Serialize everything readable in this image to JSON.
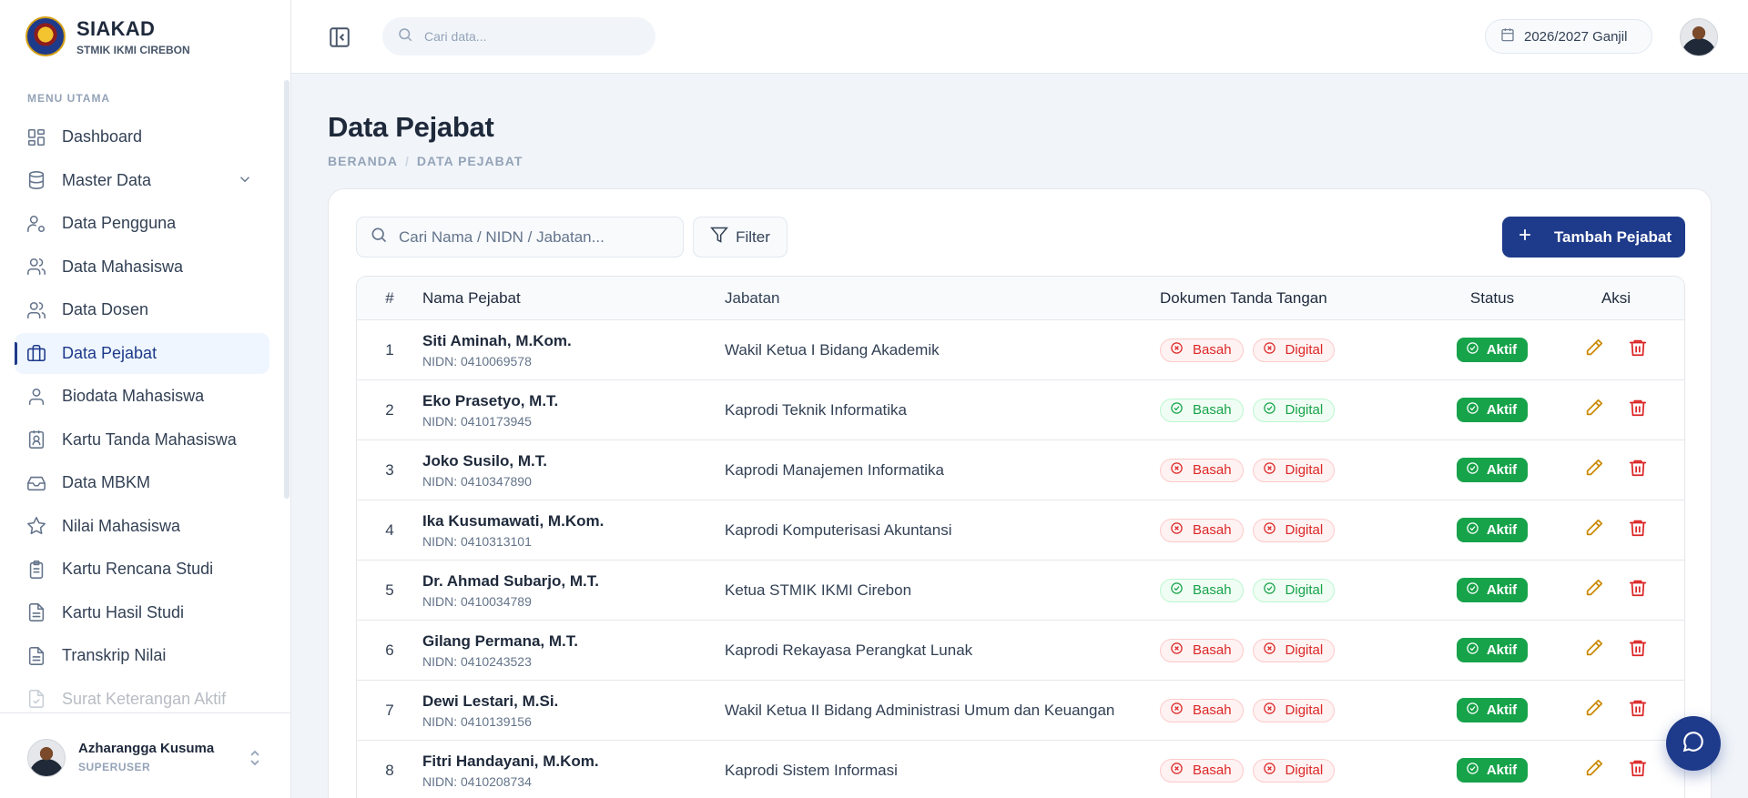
{
  "app": {
    "title": "SIAKAD",
    "subtitle": "STMIK IKMI CIREBON"
  },
  "sidebar": {
    "section_label": "MENU UTAMA",
    "items": [
      {
        "label": "Dashboard",
        "icon": "dashboard-icon"
      },
      {
        "label": "Master Data",
        "icon": "database-icon"
      },
      {
        "label": "Data Pengguna",
        "icon": "user-cog-icon"
      },
      {
        "label": "Data Mahasiswa",
        "icon": "users-icon"
      },
      {
        "label": "Data Dosen",
        "icon": "users-icon"
      },
      {
        "label": "Data Pejabat",
        "icon": "briefcase-icon"
      },
      {
        "label": "Biodata Mahasiswa",
        "icon": "user-icon"
      },
      {
        "label": "Kartu Tanda Mahasiswa",
        "icon": "id-card-icon"
      },
      {
        "label": "Data MBKM",
        "icon": "inbox-icon"
      },
      {
        "label": "Nilai Mahasiswa",
        "icon": "star-icon"
      },
      {
        "label": "Kartu Rencana Studi",
        "icon": "clipboard-icon"
      },
      {
        "label": "Kartu Hasil Studi",
        "icon": "file-text-icon"
      },
      {
        "label": "Transkrip Nilai",
        "icon": "file-text-icon"
      },
      {
        "label": "Surat Keterangan Aktif",
        "icon": "file-check-icon"
      }
    ],
    "active_item": "Data Pejabat",
    "user": {
      "name": "Azharangga Kusuma",
      "role": "SUPERUSER"
    }
  },
  "topbar": {
    "search_placeholder": "Cari data...",
    "period": "2026/2027 Ganjil"
  },
  "main": {
    "title": "Data Pejabat",
    "breadcrumb": [
      "BERANDA",
      "DATA PEJABAT"
    ],
    "search_placeholder": "Cari Nama / NIDN / Jabatan...",
    "filter_label": "Filter",
    "add_label": "Tambah Pejabat",
    "columns": [
      "#",
      "Nama Pejabat",
      "Jabatan",
      "Dokumen Tanda Tangan",
      "Status",
      "Aksi"
    ],
    "doc_labels": {
      "wet": "Basah",
      "digital": "Digital"
    },
    "rows": [
      {
        "no": "1",
        "name": "Siti Aminah, M.Kom.",
        "nidn": "NIDN: 0410069578",
        "jabatan": "Wakil Ketua I Bidang Akademik",
        "basah": false,
        "digital": false,
        "status": "Aktif"
      },
      {
        "no": "2",
        "name": "Eko Prasetyo, M.T.",
        "nidn": "NIDN: 0410173945",
        "jabatan": "Kaprodi Teknik Informatika",
        "basah": true,
        "digital": true,
        "status": "Aktif"
      },
      {
        "no": "3",
        "name": "Joko Susilo, M.T.",
        "nidn": "NIDN: 0410347890",
        "jabatan": "Kaprodi Manajemen Informatika",
        "basah": false,
        "digital": false,
        "status": "Aktif"
      },
      {
        "no": "4",
        "name": "Ika Kusumawati, M.Kom.",
        "nidn": "NIDN: 0410313101",
        "jabatan": "Kaprodi Komputerisasi Akuntansi",
        "basah": false,
        "digital": false,
        "status": "Aktif"
      },
      {
        "no": "5",
        "name": "Dr. Ahmad Subarjo, M.T.",
        "nidn": "NIDN: 0410034789",
        "jabatan": "Ketua STMIK IKMI Cirebon",
        "basah": true,
        "digital": true,
        "status": "Aktif"
      },
      {
        "no": "6",
        "name": "Gilang Permana, M.T.",
        "nidn": "NIDN: 0410243523",
        "jabatan": "Kaprodi Rekayasa Perangkat Lunak",
        "basah": false,
        "digital": false,
        "status": "Aktif"
      },
      {
        "no": "7",
        "name": "Dewi Lestari, M.Si.",
        "nidn": "NIDN: 0410139156",
        "jabatan": "Wakil Ketua II Bidang Administrasi Umum dan Keuangan",
        "basah": false,
        "digital": false,
        "status": "Aktif"
      },
      {
        "no": "8",
        "name": "Fitri Handayani, M.Kom.",
        "nidn": "NIDN: 0410208734",
        "jabatan": "Kaprodi Sistem Informasi",
        "basah": false,
        "digital": false,
        "status": "Aktif"
      }
    ]
  },
  "colors": {
    "primary": "#1e3a8a",
    "success": "#16a34a",
    "danger": "#dc2626",
    "warning": "#ca8a04"
  }
}
